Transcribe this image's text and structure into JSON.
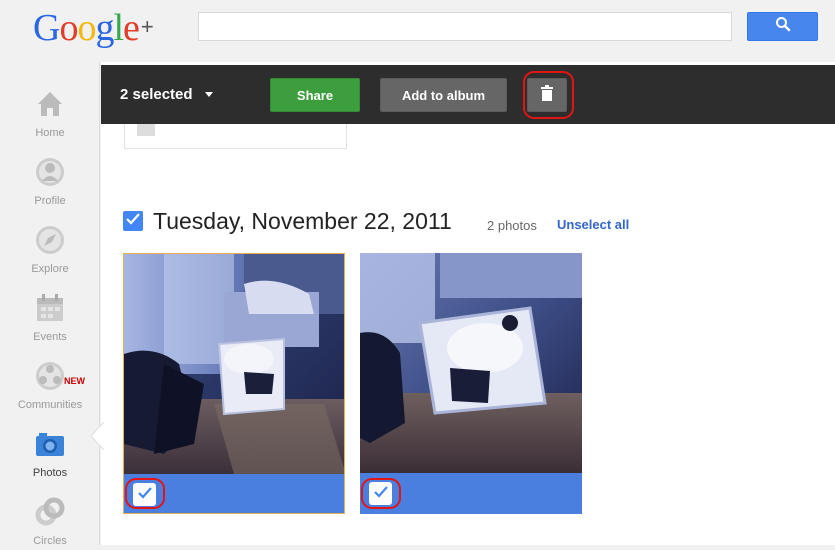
{
  "app": {
    "logo_text": "Google",
    "logo_plus": "+",
    "logo_colors": [
      "#2a67e0",
      "#e03d2a",
      "#f5b80d",
      "#2a67e0",
      "#34a850",
      "#e03d2a"
    ]
  },
  "search": {
    "placeholder": "",
    "value": "",
    "button_icon": "search-icon"
  },
  "sidebar": {
    "items": [
      {
        "label": "Home",
        "icon": "home-icon"
      },
      {
        "label": "Profile",
        "icon": "profile-icon"
      },
      {
        "label": "Explore",
        "icon": "compass-icon"
      },
      {
        "label": "Events",
        "icon": "calendar-icon"
      },
      {
        "label": "Communities",
        "icon": "communities-icon",
        "badge": "NEW"
      },
      {
        "label": "Photos",
        "icon": "camera-icon",
        "active": true
      },
      {
        "label": "Circles",
        "icon": "circles-icon"
      }
    ]
  },
  "action_bar": {
    "selected_label": "2 selected",
    "share_label": "Share",
    "add_to_album_label": "Add to album",
    "delete_icon": "trash-icon",
    "colors": {
      "bar": "#2d2d2d",
      "share": "#3d9e3d",
      "secondary": "#666666"
    }
  },
  "album": {
    "date_title": "Tuesday, November 22, 2011",
    "photo_count": "2 photos",
    "unselect_all_label": "Unselect all",
    "photos": [
      {
        "selected": true
      },
      {
        "selected": true
      }
    ]
  },
  "accent": {
    "selection_blue": "#4285f4",
    "highlight_red": "#e31414"
  }
}
